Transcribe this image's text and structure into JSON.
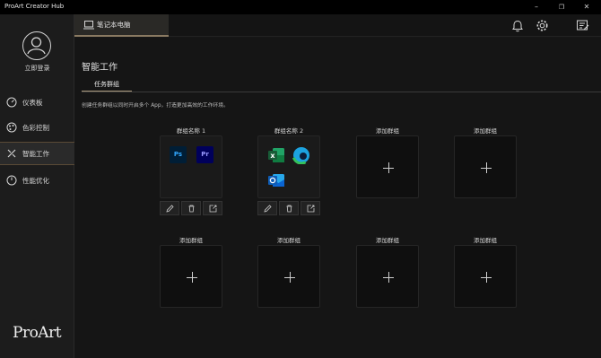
{
  "window": {
    "title": "ProArt Creator Hub",
    "controls": [
      "minimize-icon",
      "maximize-icon",
      "close-icon"
    ]
  },
  "sidebar": {
    "login_label": "立即登录",
    "items": [
      {
        "label": "仪表板",
        "icon": "gauge-icon",
        "active": false
      },
      {
        "label": "色彩控制",
        "icon": "palette-icon",
        "active": false
      },
      {
        "label": "智能工作",
        "icon": "tools-icon",
        "active": true
      },
      {
        "label": "性能优化",
        "icon": "performance-icon",
        "active": false
      }
    ],
    "logo": "ProArt"
  },
  "topbar": {
    "device_tab": "笔记本电脑",
    "icons": [
      "bell-icon",
      "gear-icon",
      "feedback-icon"
    ]
  },
  "main": {
    "title": "智能工作",
    "subtab": "任务群组",
    "description": "创建任务群组以同时开启多个 App，打造更加高效的工作环境。",
    "groups": [
      {
        "name": "群组名称 1",
        "filled": true,
        "apps": [
          "Ps",
          "Pr"
        ]
      },
      {
        "name": "群组名称 2",
        "filled": true,
        "apps": [
          "excel-icon",
          "edge-icon",
          "outlook-icon"
        ]
      },
      {
        "name": "添加群组",
        "filled": false
      },
      {
        "name": "添加群组",
        "filled": false
      },
      {
        "name": "添加群组",
        "filled": false
      },
      {
        "name": "添加群组",
        "filled": false
      },
      {
        "name": "添加群组",
        "filled": false
      },
      {
        "name": "添加群组",
        "filled": false
      }
    ],
    "group_actions": [
      "edit-icon",
      "delete-icon",
      "export-icon"
    ]
  },
  "colors": {
    "accent": "#a9987c",
    "background": "#151515",
    "sidebar": "#1c1c1c",
    "photoshop": "#31a8ff",
    "premiere": "#9999ff",
    "excel": "#1d6f42",
    "outlook": "#0a64d2"
  }
}
